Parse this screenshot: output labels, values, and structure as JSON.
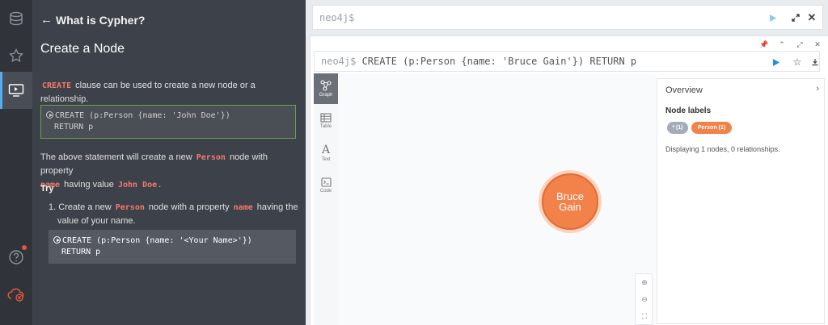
{
  "guide": {
    "back_title": "What is Cypher?",
    "heading": "Create a Node",
    "intro_keyword": "CREATE",
    "intro_text": " clause can be used to create a new node or a relationship.",
    "example_line1": "CREATE (p:Person {name: 'John Doe'})",
    "example_line2": "RETURN p",
    "explain_part1": "The above statement will create a new ",
    "explain_kw1": "Person",
    "explain_part2": " node with property",
    "explain_kw2": "name",
    "explain_part3": " having value ",
    "explain_kw3": "John Doe",
    "explain_part4": ".",
    "try_label": "Try",
    "step_number": "1.",
    "step_part1": "Create a new ",
    "step_kw1": "Person",
    "step_part2": " node with a property ",
    "step_kw2": "name",
    "step_part3": " having the",
    "step_part4": "value of your name.",
    "try_line1": "CREATE (p:Person {name: '<Your Name>'})",
    "try_line2": "RETURN p"
  },
  "topbar": {
    "prompt": "neo4j$"
  },
  "frame": {
    "prompt": "neo4j$",
    "query": " CREATE (p:Person {name: 'Bruce Gain'}) RETURN p",
    "tabs": [
      {
        "label": "Graph"
      },
      {
        "label": "Table"
      },
      {
        "label": "Text"
      },
      {
        "label": "Code"
      }
    ],
    "node": {
      "line1": "Bruce",
      "line2": "Gain",
      "color": "#f2824a"
    }
  },
  "overview": {
    "title": "Overview",
    "labels_heading": "Node labels",
    "pills": [
      {
        "label": "* (1)",
        "color": "#a5abb6"
      },
      {
        "label": "Person (1)",
        "color": "#f2824a"
      }
    ],
    "description": "Displaying 1 nodes, 0 relationships."
  },
  "colors": {
    "accent": "#55acee",
    "keyword": "#f37a6e",
    "alert": "#e2573d"
  }
}
